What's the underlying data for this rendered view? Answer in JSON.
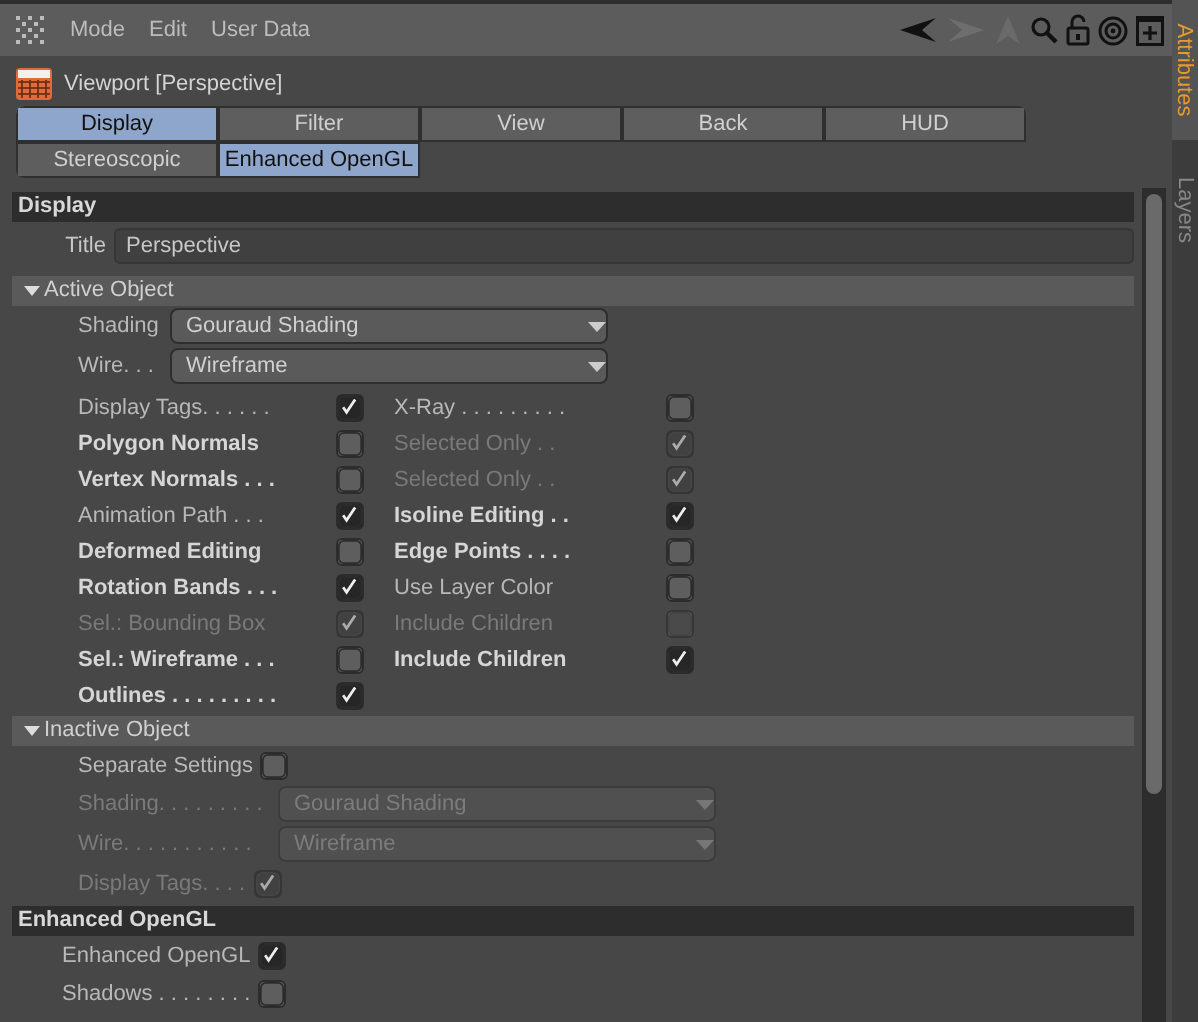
{
  "menu": {
    "items": [
      "Mode",
      "Edit",
      "User Data"
    ]
  },
  "object": {
    "title": "Viewport [Perspective]"
  },
  "tabs": [
    {
      "label": "Display",
      "selected": true
    },
    {
      "label": "Filter",
      "selected": false
    },
    {
      "label": "View",
      "selected": false
    },
    {
      "label": "Back",
      "selected": false
    },
    {
      "label": "HUD",
      "selected": false
    },
    {
      "label": "Stereoscopic",
      "selected": false
    },
    {
      "label": "Enhanced OpenGL",
      "selected": true
    }
  ],
  "side_tabs": [
    {
      "label": "Attributes",
      "selected": true
    },
    {
      "label": "Layers",
      "selected": false
    }
  ],
  "sections": [
    {
      "kind": "heading",
      "title": "Display"
    },
    {
      "kind": "field",
      "label": "Title",
      "value": "Perspective"
    },
    {
      "kind": "group",
      "title": "Active Object",
      "expanded": true
    },
    {
      "kind": "dropdown",
      "label": "Shading",
      "value": "Gouraud Shading",
      "disabled": false
    },
    {
      "kind": "dropdown",
      "label": "Wire. . .",
      "value": "Wireframe",
      "disabled": false
    },
    {
      "kind": "checks",
      "items": [
        {
          "label": "Display Tags. . . . . .",
          "bold": false,
          "checked": true,
          "disabled": false
        },
        {
          "label": "X-Ray . . . . . . . . .",
          "bold": false,
          "checked": false,
          "disabled": false
        },
        {
          "label": "Polygon Normals",
          "bold": true,
          "checked": false,
          "disabled": false
        },
        {
          "label": "Selected Only . .",
          "bold": false,
          "checked": true,
          "disabled": true
        },
        {
          "label": "Vertex Normals . . .",
          "bold": true,
          "checked": false,
          "disabled": false
        },
        {
          "label": "Selected Only . .",
          "bold": false,
          "checked": true,
          "disabled": true
        },
        {
          "label": "Animation Path . . .",
          "bold": false,
          "checked": true,
          "disabled": false
        },
        {
          "label": "Isoline Editing . .",
          "bold": true,
          "checked": true,
          "disabled": false
        },
        {
          "label": "Deformed Editing",
          "bold": true,
          "checked": false,
          "disabled": false
        },
        {
          "label": "Edge Points . . . .",
          "bold": true,
          "checked": false,
          "disabled": false
        },
        {
          "label": "Rotation Bands . . .",
          "bold": true,
          "checked": true,
          "disabled": false
        },
        {
          "label": "Use Layer Color",
          "bold": false,
          "checked": false,
          "disabled": false
        },
        {
          "label": "Sel.: Bounding Box",
          "bold": false,
          "checked": true,
          "disabled": true
        },
        {
          "label": "Include Children",
          "bold": false,
          "checked": false,
          "disabled": true
        },
        {
          "label": "Sel.: Wireframe . . .",
          "bold": true,
          "checked": false,
          "disabled": false
        },
        {
          "label": "Include Children",
          "bold": true,
          "checked": true,
          "disabled": false
        },
        {
          "label": "Outlines . . . . . . . . .",
          "bold": true,
          "checked": true,
          "disabled": false
        }
      ]
    },
    {
      "kind": "group",
      "title": "Inactive Object",
      "expanded": true
    },
    {
      "kind": "check",
      "label": "Separate Settings",
      "checked": false,
      "disabled": false
    },
    {
      "kind": "dropdown",
      "label": "Shading. . . . . . . . .",
      "value": "Gouraud Shading",
      "disabled": true
    },
    {
      "kind": "dropdown",
      "label": "Wire. . . . . . . . . . .",
      "value": "Wireframe",
      "disabled": true
    },
    {
      "kind": "check",
      "label": "Display Tags. . . .",
      "checked": true,
      "disabled": true
    },
    {
      "kind": "heading",
      "title": "Enhanced OpenGL"
    },
    {
      "kind": "option",
      "label": "Enhanced OpenGL",
      "checked": true,
      "disabled": false
    },
    {
      "kind": "option",
      "label": "Shadows . . . . . . . .",
      "checked": false,
      "disabled": false
    }
  ]
}
